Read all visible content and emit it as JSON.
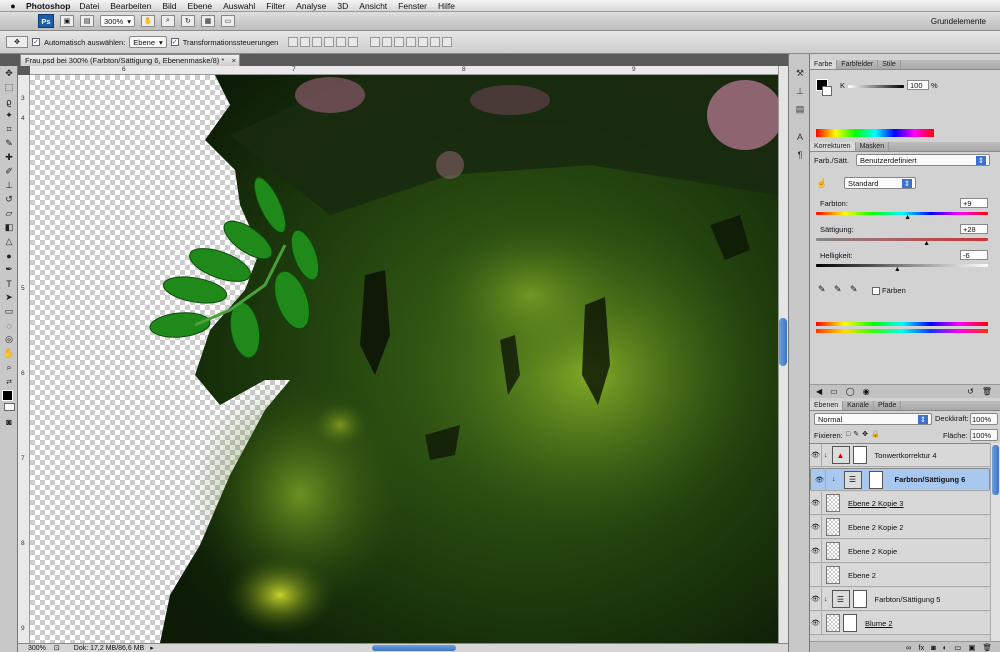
{
  "menubar": {
    "app_name": "Photoshop",
    "items": [
      "Datei",
      "Bearbeiten",
      "Bild",
      "Ebene",
      "Auswahl",
      "Filter",
      "Analyse",
      "3D",
      "Ansicht",
      "Fenster",
      "Hilfe"
    ]
  },
  "appbar": {
    "ps_label": "Ps",
    "zoom": "300%",
    "workspace": "Grundelemente"
  },
  "options": {
    "auto_select_label": "Automatisch auswählen:",
    "auto_select_value": "Ebene",
    "transform_label": "Transformationssteuerungen"
  },
  "document": {
    "tab_title": "Frau.psd bei 300% (Farbton/Sättigung 6, Ebenenmaske/8) *",
    "ruler_top": [
      "6",
      "7",
      "8",
      "9"
    ],
    "ruler_left": [
      "3",
      "4",
      "5",
      "6",
      "7",
      "8",
      "9"
    ],
    "status_zoom": "300%",
    "status_doc": "Dok: 17,2 MB/86,6 MB"
  },
  "color_panel": {
    "tabs": [
      "Farbe",
      "Farbfelder",
      "Stile"
    ],
    "channel_label": "K",
    "k_value": "100",
    "percent": "%"
  },
  "adjustments": {
    "tabs": [
      "Korrekturen",
      "Masken"
    ],
    "type_label": "Farb./Sätt.",
    "preset": "Benutzerdefiniert",
    "edit": "Standard",
    "hue_label": "Farbton:",
    "hue_value": "+9",
    "hue_fraction": 0.53,
    "sat_label": "Sättigung:",
    "sat_value": "+28",
    "sat_fraction": 0.64,
    "light_label": "Helligkeit:",
    "light_value": "-6",
    "light_fraction": 0.47,
    "colorize_label": "Färben"
  },
  "layers_panel": {
    "tabs": [
      "Ebenen",
      "Kanäle",
      "Pfade"
    ],
    "blend_mode": "Normal",
    "opacity_label": "Deckkraft:",
    "opacity_value": "100%",
    "lock_label": "Fixieren:",
    "fill_label": "Fläche:",
    "fill_value": "100%",
    "layers": [
      {
        "name": "Tonwertkorrektur 4",
        "kind": "adjustment",
        "visible": true,
        "selected": false
      },
      {
        "name": "Farbton/Sättigung 6",
        "kind": "adjustment",
        "visible": true,
        "selected": true
      },
      {
        "name": "Ebene 2 Kopie 3",
        "kind": "pixel",
        "visible": true,
        "selected": false
      },
      {
        "name": "Ebene 2 Kopie 2",
        "kind": "pixel",
        "visible": true,
        "selected": false
      },
      {
        "name": "Ebene 2 Kopie",
        "kind": "pixel",
        "visible": true,
        "selected": false
      },
      {
        "name": "Ebene 2",
        "kind": "pixel",
        "visible": false,
        "selected": false
      },
      {
        "name": "Farbton/Sättigung 5",
        "kind": "adjustment",
        "visible": true,
        "selected": false
      },
      {
        "name": "Blume 2",
        "kind": "pixel",
        "visible": true,
        "selected": false
      }
    ]
  }
}
